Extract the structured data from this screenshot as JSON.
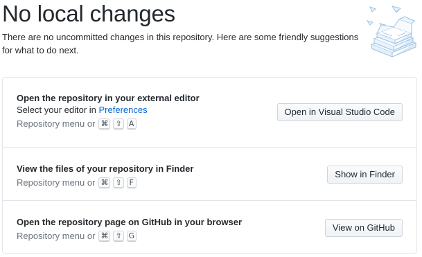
{
  "header": {
    "title": "No local changes",
    "description_line1": "There are no uncommitted changes in this repository. Here are some friendly suggestions",
    "description_line2": "for what to do next."
  },
  "suggestions": [
    {
      "title": "Open the repository in your external editor",
      "subtitle_prefix": "Select your editor in ",
      "subtitle_link": "Preferences",
      "menu_text": "Repository menu or",
      "keys": [
        "⌘",
        "⇧",
        "A"
      ],
      "button": "Open in Visual Studio Code"
    },
    {
      "title": "View the files of your repository in Finder",
      "menu_text": "Repository menu or",
      "keys": [
        "⌘",
        "⇧",
        "F"
      ],
      "button": "Show in Finder"
    },
    {
      "title": "Open the repository page on GitHub in your browser",
      "menu_text": "Repository menu or",
      "keys": [
        "⌘",
        "⇧",
        "G"
      ],
      "button": "View on GitHub"
    }
  ],
  "colors": {
    "link": "#0366d6",
    "muted": "#6a737d",
    "border": "#e1e4e8",
    "illustration": "#9cc2e5"
  },
  "icons": {
    "illustration": "paper-stack-illustration",
    "command": "command-key-icon",
    "shift": "shift-key-icon"
  }
}
